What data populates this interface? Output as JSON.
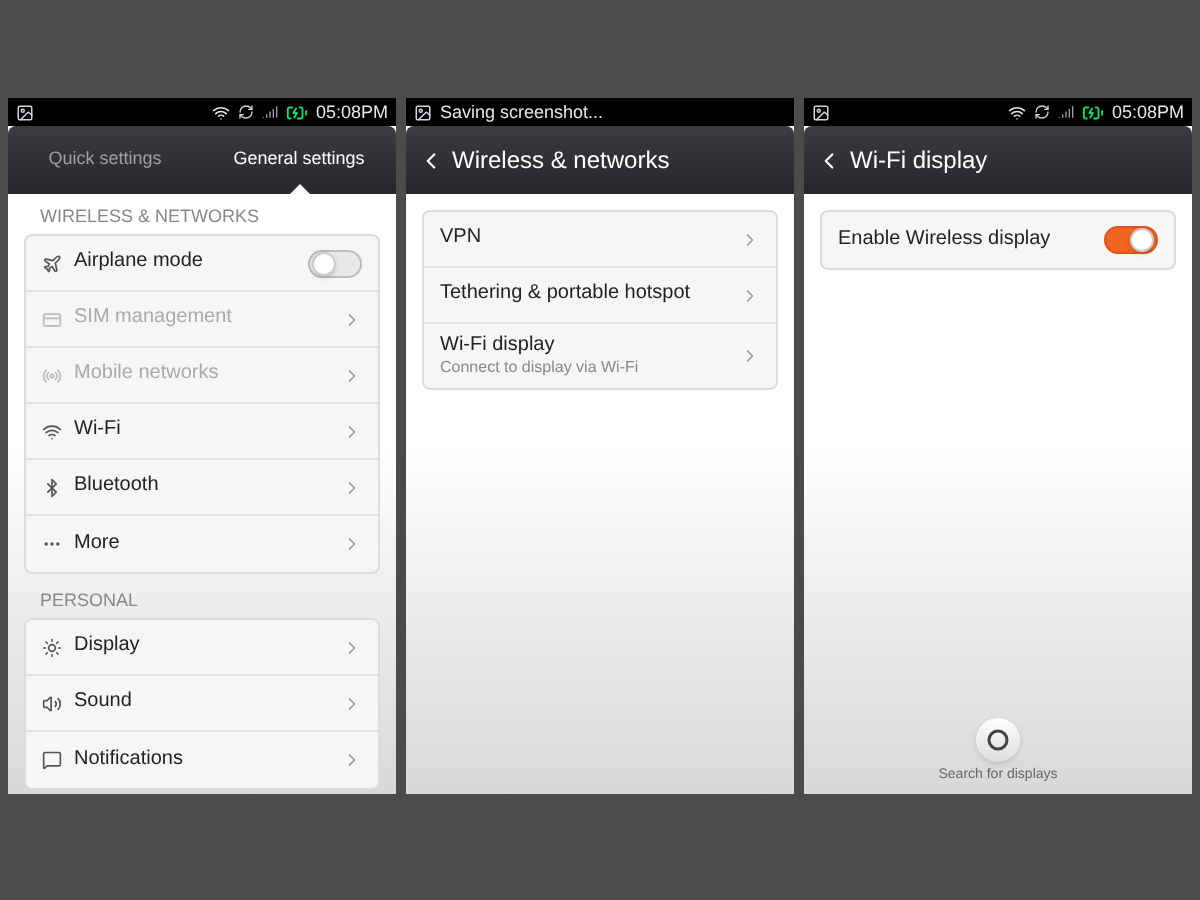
{
  "screens": [
    {
      "kind": "settings",
      "status_bar": {
        "time": "05:08PM"
      },
      "tabs": [
        {
          "label": "Quick settings",
          "selected": false
        },
        {
          "label": "General settings",
          "selected": true
        }
      ],
      "sections": [
        {
          "title": "WIRELESS & NETWORKS",
          "items": [
            {
              "kind": "toggle",
              "label": "Airplane mode",
              "on": false,
              "disabled": false
            },
            {
              "kind": "link",
              "label": "SIM management",
              "disabled": true
            },
            {
              "kind": "link",
              "label": "Mobile networks",
              "disabled": true
            },
            {
              "kind": "link",
              "label": "Wi-Fi",
              "disabled": false
            },
            {
              "kind": "link",
              "label": "Bluetooth",
              "disabled": false
            },
            {
              "kind": "link",
              "label": "More",
              "disabled": false
            }
          ]
        },
        {
          "title": "PERSONAL",
          "items": [
            {
              "kind": "link",
              "label": "Display",
              "disabled": false
            },
            {
              "kind": "link",
              "label": "Sound",
              "disabled": false
            },
            {
              "kind": "link",
              "label": "Notifications",
              "disabled": false
            }
          ]
        }
      ]
    },
    {
      "kind": "list",
      "status_bar": {
        "notice": "Saving screenshot..."
      },
      "title": "Wireless & networks",
      "items": [
        {
          "kind": "link",
          "label": "VPN"
        },
        {
          "kind": "link",
          "label": "Tethering & portable hotspot"
        },
        {
          "kind": "link",
          "label": "Wi-Fi display",
          "subtitle": "Connect to display via Wi-Fi"
        }
      ]
    },
    {
      "kind": "list",
      "status_bar": {
        "time": "05:08PM"
      },
      "title": "Wi-Fi display",
      "items": [
        {
          "kind": "toggle",
          "label": "Enable Wireless display",
          "on": true
        }
      ],
      "footer_action": "Search for displays"
    }
  ]
}
